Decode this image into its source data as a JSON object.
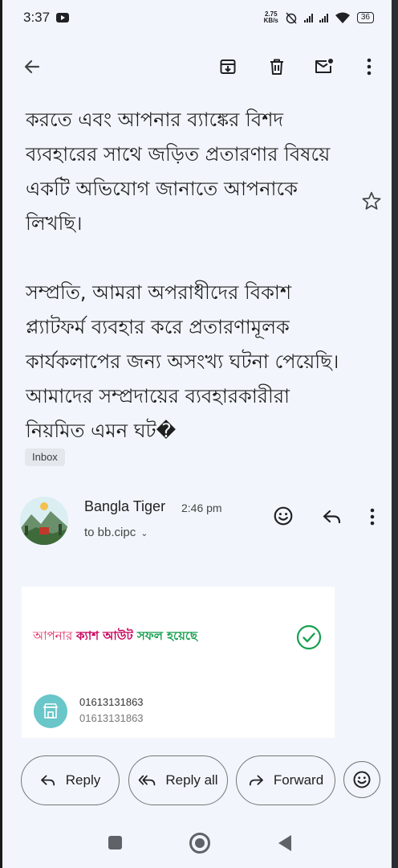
{
  "status_bar": {
    "time": "3:37",
    "net_speed_value": "2.75",
    "net_speed_unit": "KB/s",
    "battery": "36"
  },
  "email": {
    "body_paragraph_1": "করতে এবং আপনার ব্যাঙ্কের বিশদ ব্যবহারের সাথে জড়িত প্রতারণার বিষয়ে একটি অভিযোগ জানাতে আপনাকে লিখছি।",
    "body_paragraph_2": "সম্প্রতি, আমরা অপরাধীদের বিকাশ প্ল্যাটফর্ম ব্যবহার করে প্রতারণামূলক কার্যকলাপের জন্য অসংখ্য ঘটনা পেয়েছি। আমাদের সম্প্রদায়ের ব্যবহারকারীরা নিয়মিত এমন ঘট�",
    "label_chip": "Inbox"
  },
  "sender": {
    "name": "Bangla Tiger",
    "time": "2:46 pm",
    "to": "to bb.cipc"
  },
  "receipt": {
    "title_part1": "আপনার ",
    "title_part2": "ক্যাশ আউট",
    "title_part3": " সফল হয়েছে",
    "number_primary": "01613131863",
    "number_secondary": "01613131863"
  },
  "actions": {
    "reply": "Reply",
    "reply_all": "Reply all",
    "forward": "Forward"
  },
  "icons": {
    "back": "arrow-back-icon",
    "archive": "archive-icon",
    "delete": "trash-icon",
    "mark_unread": "mail-unread-icon",
    "more": "more-vert-icon",
    "star": "star-outline-icon",
    "emoji": "add-reaction-icon",
    "success": "check-circle-icon"
  },
  "colors": {
    "background": "#f2f6fc",
    "receipt_pink": "#e0245e",
    "receipt_green": "#18a050",
    "store_icon_bg": "#69c6c9"
  }
}
